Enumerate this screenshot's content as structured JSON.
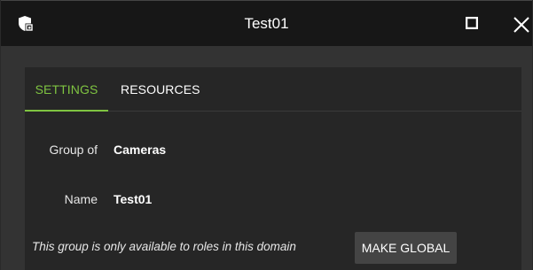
{
  "window": {
    "title": "Test01",
    "app_icon": "group-shield-icon",
    "maximize_icon": "maximize-icon",
    "close_icon": "close-icon"
  },
  "tabs": [
    {
      "label": "SETTINGS",
      "active": true
    },
    {
      "label": "RESOURCES",
      "active": false
    }
  ],
  "fields": {
    "group_of": {
      "label": "Group of",
      "value": "Cameras"
    },
    "name": {
      "label": "Name",
      "value": "Test01"
    }
  },
  "note": "This group is only available to roles in this domain",
  "make_global_label": "MAKE GLOBAL",
  "colors": {
    "accent": "#7fc441",
    "titlebar": "#171717",
    "panel": "#262626",
    "background": "#333333",
    "button": "#444444"
  }
}
